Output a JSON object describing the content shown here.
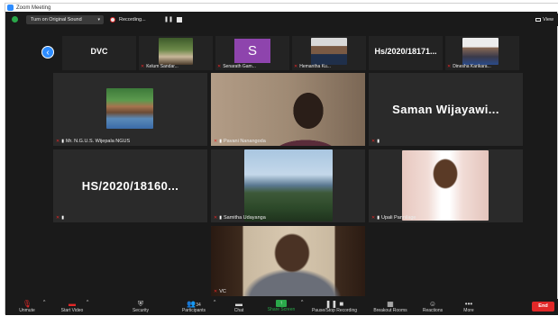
{
  "window": {
    "title": "Zoom Meeting"
  },
  "topbar": {
    "sound_label": "Turn on Original Sound",
    "recording_label": "Recording...",
    "view_label": "View"
  },
  "strip": [
    {
      "kind": "text",
      "label": "DVC",
      "name": ""
    },
    {
      "kind": "photo",
      "label": "",
      "name": "Kelum Sandar..."
    },
    {
      "kind": "avatar",
      "label": "S",
      "name": "Senarath Gam..."
    },
    {
      "kind": "photo",
      "label": "",
      "name": "Hemantha Ku..."
    },
    {
      "kind": "text",
      "label": "Hs/2020/18171...",
      "name": ""
    },
    {
      "kind": "photo",
      "label": "",
      "name": "Dinesha Karikara..."
    }
  ],
  "grid": [
    {
      "name": "Mr. N.G.U.S. Wijepala NGUS",
      "big": ""
    },
    {
      "name": "Pavani Nanangoda",
      "big": ""
    },
    {
      "name": "",
      "big": "Saman Wijayawi..."
    },
    {
      "name": "",
      "big": "HS/2020/18160..."
    },
    {
      "name": "Samitha Udayanga",
      "big": ""
    },
    {
      "name": "Upali Pannilage",
      "big": ""
    },
    {
      "name": "VC",
      "big": ""
    }
  ],
  "toolbar": {
    "unmute": "Unmute",
    "start_video": "Start Video",
    "security": "Security",
    "participants": "Participants",
    "participants_count": "34",
    "chat": "Chat",
    "share_screen": "Share Screen",
    "recording": "Pause/Stop Recording",
    "breakout": "Breakout Rooms",
    "reactions": "Reactions",
    "more": "More",
    "end": "End"
  },
  "icons": {
    "mute": "muted-mic-icon",
    "video": "video-off-icon"
  },
  "colors": {
    "accent": "#2d8cff",
    "share": "#2aa84a",
    "end": "#e02828",
    "avatar": "#8e44ad"
  }
}
